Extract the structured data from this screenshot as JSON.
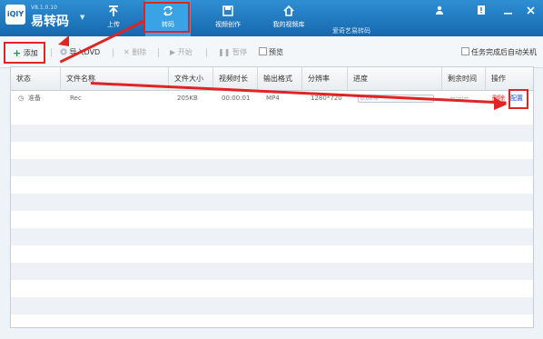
{
  "app": {
    "version": "V8.1.0.10",
    "name": "易转码",
    "logo_text": "iQIY"
  },
  "nav": [
    {
      "label": "上传",
      "icon": "upload-icon"
    },
    {
      "label": "转码",
      "icon": "transcode-icon",
      "active": true
    },
    {
      "label": "视频创作",
      "icon": "save-icon"
    },
    {
      "label": "我的视频库",
      "icon": "home-icon"
    }
  ],
  "window_controls": [
    "user-icon",
    "info-icon",
    "minimize-icon",
    "close-icon"
  ],
  "watermark": "爱奇艺易转码",
  "toolbar": {
    "add": "添加",
    "import_dvd": "导入DVD",
    "delete": "删除",
    "start": "开始",
    "pause": "暂停",
    "preview": "预览",
    "shutdown": "任务完成后自动关机"
  },
  "columns": [
    "状态",
    "文件名称",
    "文件大小",
    "视频时长",
    "输出格式",
    "分辨率",
    "进度",
    "剩余时间",
    "操作"
  ],
  "rows": [
    {
      "status": "准备",
      "filename": "Rec",
      "size": "205KB",
      "duration": "00:00:01",
      "format": "MP4",
      "resolution": "1280*720",
      "progress_text": "0.00%",
      "progress": 0.0,
      "remaining": "--:--:--",
      "action_delete": "删除",
      "action_config": "配置"
    }
  ],
  "colors": {
    "header_top": "#2f8ed3",
    "header_bottom": "#1768ad",
    "annotation_red": "#e02323",
    "link_red": "#e02323",
    "link_blue": "#1a4fd6"
  }
}
